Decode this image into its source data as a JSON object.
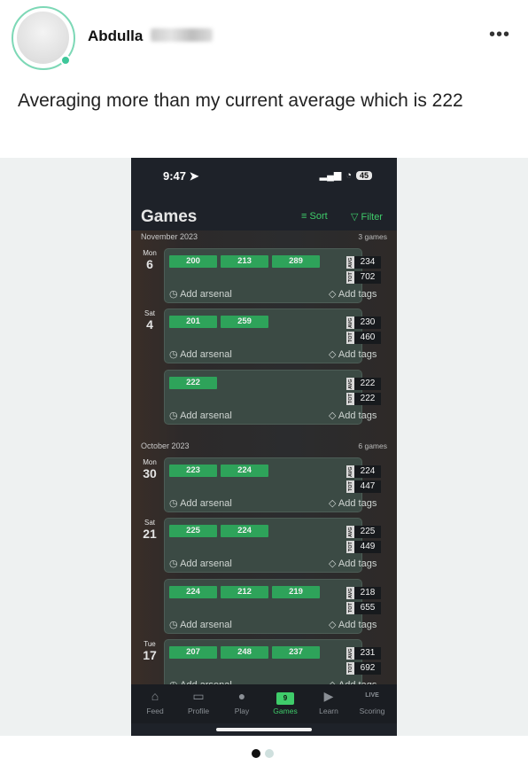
{
  "post": {
    "author": "Abdulla",
    "text": "Averaging more than my current average which is 222",
    "more_label": "•••"
  },
  "phone": {
    "status": {
      "time": "9:47",
      "battery": "45"
    },
    "header": {
      "title": "Games",
      "sort_label": "Sort",
      "filter_label": "Filter"
    },
    "sections": [
      {
        "month": "November 2023",
        "count": "3 games"
      },
      {
        "month": "October 2023",
        "count": "6 games"
      }
    ],
    "days": [
      {
        "name": "Mon",
        "num": "6"
      },
      {
        "name": "Sat",
        "num": "4"
      },
      {
        "name": "Mon",
        "num": "30"
      },
      {
        "name": "Sat",
        "num": "21"
      },
      {
        "name": "Tue",
        "num": "17"
      }
    ],
    "cards": [
      {
        "scores": [
          "200",
          "213",
          "289"
        ],
        "avg": "234",
        "tot": "702"
      },
      {
        "scores": [
          "201",
          "259"
        ],
        "avg": "230",
        "tot": "460"
      },
      {
        "scores": [
          "222"
        ],
        "avg": "222",
        "tot": "222"
      },
      {
        "scores": [
          "223",
          "224"
        ],
        "avg": "224",
        "tot": "447"
      },
      {
        "scores": [
          "225",
          "224"
        ],
        "avg": "225",
        "tot": "449"
      },
      {
        "scores": [
          "224",
          "212",
          "219"
        ],
        "avg": "218",
        "tot": "655"
      },
      {
        "scores": [
          "207",
          "248",
          "237"
        ],
        "avg": "231",
        "tot": "692"
      }
    ],
    "labels": {
      "avg": "AVG",
      "tot": "TOT",
      "arsenal": "Add arsenal",
      "tags": "Add tags"
    },
    "tabs": [
      {
        "label": "Feed"
      },
      {
        "label": "Profile"
      },
      {
        "label": "Play"
      },
      {
        "label": "Games",
        "icon_text": "9"
      },
      {
        "label": "Learn"
      },
      {
        "label": "Scoring",
        "icon_text": "LIVE"
      }
    ]
  },
  "carousel": {
    "active_index": 0,
    "count": 2
  }
}
